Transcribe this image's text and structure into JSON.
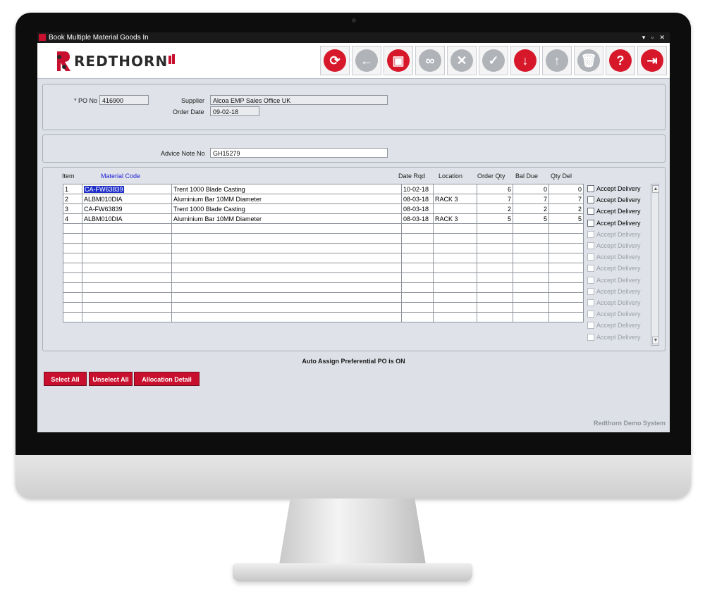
{
  "window": {
    "title": "Book Multiple Material Goods In"
  },
  "logo": {
    "text": "REDTHORN"
  },
  "toolbar": {
    "buttons": [
      {
        "icon": "refresh-icon",
        "glyph": "⟳",
        "style": "red"
      },
      {
        "icon": "back-arrow-icon",
        "glyph": "←",
        "style": "grey"
      },
      {
        "icon": "save-icon",
        "glyph": "▣",
        "style": "red"
      },
      {
        "icon": "binoculars-icon",
        "glyph": "∞",
        "style": "grey"
      },
      {
        "icon": "cancel-icon",
        "glyph": "✕",
        "style": "grey"
      },
      {
        "icon": "confirm-check-icon",
        "glyph": "✓",
        "style": "grey"
      },
      {
        "icon": "down-arrow-icon",
        "glyph": "↓",
        "style": "red"
      },
      {
        "icon": "up-arrow-icon",
        "glyph": "↑",
        "style": "grey"
      },
      {
        "icon": "delete-trash-icon",
        "glyph": "🗑",
        "style": "grey"
      },
      {
        "icon": "help-icon",
        "glyph": "?",
        "style": "red"
      },
      {
        "icon": "exit-icon",
        "glyph": "⇥",
        "style": "red"
      }
    ]
  },
  "header": {
    "po_label": "* PO No",
    "po_value": "416900",
    "supplier_label": "Supplier",
    "supplier_value": "Alcoa EMP Sales Office UK",
    "order_date_label": "Order Date",
    "order_date_value": "09-02-18"
  },
  "advice": {
    "label": "Advice Note No",
    "value": "GH15279"
  },
  "grid": {
    "headers": {
      "item": "Item",
      "material_code": "Material Code",
      "date_rqd": "Date Rqd",
      "location": "Location",
      "order_qty": "Order Qty",
      "bal_due": "Bal Due",
      "qty_del": "Qty Del"
    },
    "rows": [
      {
        "item": "1",
        "code": "CA-FW63839",
        "desc": "Trent 1000 Blade Casting",
        "date": "10-02-18",
        "loc": "",
        "order": "6",
        "bal": "0",
        "del": "0"
      },
      {
        "item": "2",
        "code": "ALBM010DIA",
        "desc": "Aluminium Bar 10MM Diameter",
        "date": "08-03-18",
        "loc": "RACK 3",
        "order": "7",
        "bal": "7",
        "del": "7"
      },
      {
        "item": "3",
        "code": "CA-FW63839",
        "desc": "Trent 1000 Blade Casting",
        "date": "08-03-18",
        "loc": "",
        "order": "2",
        "bal": "2",
        "del": "2"
      },
      {
        "item": "4",
        "code": "ALBM010DIA",
        "desc": "Aluminium Bar 10MM Diameter",
        "date": "08-03-18",
        "loc": "RACK 3",
        "order": "5",
        "bal": "5",
        "del": "5"
      }
    ],
    "empty_rows": 10,
    "accept_label": "Accept Delivery"
  },
  "status": {
    "auto_assign": "Auto Assign Preferential PO is ON"
  },
  "actions": {
    "select_all": "Select All",
    "unselect_all": "Unselect All",
    "allocation_detail": "Allocation Detail"
  },
  "footer": {
    "system": "Redthorn Demo System"
  },
  "colors": {
    "brand_red": "#c8102e",
    "selection_blue": "#1f2fc8"
  }
}
